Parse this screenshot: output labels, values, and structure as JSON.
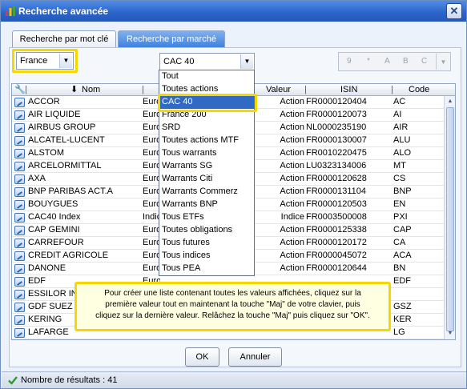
{
  "window": {
    "title": "Recherche avancée",
    "close": "✕"
  },
  "tabs": [
    {
      "label": "Recherche par mot clé",
      "active": false
    },
    {
      "label": "Recherche par marché",
      "active": true
    }
  ],
  "country_select": {
    "value": "France"
  },
  "market_select": {
    "value": "CAC 40"
  },
  "letter_filter": [
    "9",
    "*",
    "A",
    "B",
    "C"
  ],
  "table": {
    "headers": {
      "nom": "Nom",
      "valeur": "Valeur",
      "isin": "ISIN",
      "code": "Code"
    },
    "rows": [
      {
        "name": "ACCOR",
        "place": "Euro",
        "type": "Action",
        "isin": "FR0000120404",
        "code": "AC"
      },
      {
        "name": "AIR LIQUIDE",
        "place": "Euro",
        "type": "Action",
        "isin": "FR0000120073",
        "code": "AI"
      },
      {
        "name": "AIRBUS GROUP",
        "place": "Euro",
        "type": "Action",
        "isin": "NL0000235190",
        "code": "AIR"
      },
      {
        "name": "ALCATEL-LUCENT",
        "place": "Euro",
        "type": "Action",
        "isin": "FR0000130007",
        "code": "ALU"
      },
      {
        "name": "ALSTOM",
        "place": "Euro",
        "type": "Action",
        "isin": "FR0010220475",
        "code": "ALO"
      },
      {
        "name": "ARCELORMITTAL",
        "place": "Euro",
        "type": "Action",
        "isin": "LU0323134006",
        "code": "MT"
      },
      {
        "name": "AXA",
        "place": "Euro",
        "type": "Action",
        "isin": "FR0000120628",
        "code": "CS"
      },
      {
        "name": "BNP PARIBAS ACT.A",
        "place": "Euro",
        "type": "Action",
        "isin": "FR0000131104",
        "code": "BNP"
      },
      {
        "name": "BOUYGUES",
        "place": "Euro",
        "type": "Action",
        "isin": "FR0000120503",
        "code": "EN"
      },
      {
        "name": "CAC40 Index",
        "place": "Indic",
        "type": "Indice",
        "isin": "FR0003500008",
        "code": "PXI"
      },
      {
        "name": "CAP GEMINI",
        "place": "Euro",
        "type": "Action",
        "isin": "FR0000125338",
        "code": "CAP"
      },
      {
        "name": "CARREFOUR",
        "place": "Euro",
        "type": "Action",
        "isin": "FR0000120172",
        "code": "CA"
      },
      {
        "name": "CREDIT AGRICOLE",
        "place": "Euro",
        "type": "Action",
        "isin": "FR0000045072",
        "code": "ACA"
      },
      {
        "name": "DANONE",
        "place": "Euro",
        "type": "Action",
        "isin": "FR0000120644",
        "code": "BN"
      },
      {
        "name": "EDF",
        "place": "Euro",
        "type": "",
        "isin": "",
        "code": "EDF"
      },
      {
        "name": "ESSILOR IN",
        "place": "",
        "type": "",
        "isin": "",
        "code": ""
      },
      {
        "name": "GDF SUEZ",
        "place": "",
        "type": "",
        "isin": "",
        "code": "GSZ"
      },
      {
        "name": "KERING",
        "place": "",
        "type": "",
        "isin": "",
        "code": "KER"
      },
      {
        "name": "LAFARGE",
        "place": "",
        "type": "",
        "isin": "",
        "code": "LG"
      }
    ]
  },
  "dropdown_options": [
    "Tout",
    "Toutes actions",
    "CAC 40",
    "France 200",
    "SRD",
    "Toutes actions MTF",
    "Tous warrants",
    "Warrants SG",
    "Warrants Citi",
    "Warrants Commerz",
    "Warrants BNP",
    "Tous ETFs",
    "Toutes obligations",
    "Tous futures",
    "Tous indices",
    "Tous PEA"
  ],
  "dropdown_selected": "CAC 40",
  "tooltip": {
    "line1": "Pour créer une liste contenant toutes les valeurs affichées, cliquez sur la",
    "line2": "première valeur tout en maintenant la touche \"Maj\" de votre clavier, puis",
    "line3": "cliquez sur la dernière valeur. Relâchez la touche \"Maj\" puis cliquez sur \"OK\"."
  },
  "buttons": {
    "ok": "OK",
    "cancel": "Annuler"
  },
  "status": {
    "results": "Nombre de résultats : 41"
  },
  "colors": {
    "highlight": "#f5d800",
    "selection": "#316ac5",
    "titlebar": "#2a63c8"
  }
}
